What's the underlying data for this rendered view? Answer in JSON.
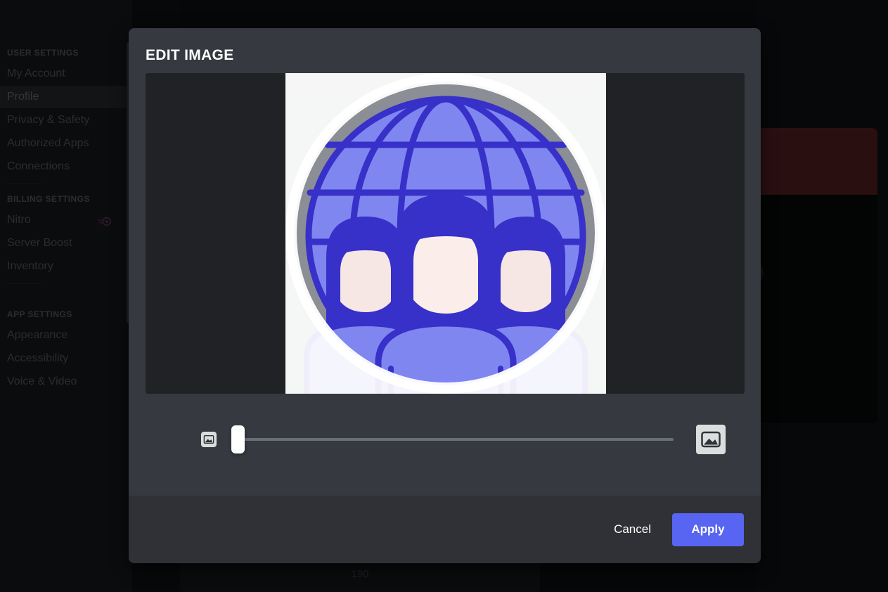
{
  "modal": {
    "title": "EDIT IMAGE",
    "preview": {
      "image_alt": "globe-with-people-avatar",
      "backdrop_color": "#8b8e94",
      "frame_color": "#202225"
    },
    "zoom_slider": {
      "name": "image-zoom-slider",
      "value": 0,
      "min": 0,
      "max": 100,
      "small_icon": "image-icon",
      "large_icon": "image-icon"
    },
    "footer": {
      "cancel_label": "Cancel",
      "apply_label": "Apply",
      "apply_color": "#5865f2"
    },
    "background_color": "#36393f",
    "footer_color": "#2f3136"
  },
  "background": {
    "sidebar": {
      "groups": [
        {
          "header": "USER SETTINGS",
          "items": [
            {
              "label": "My Account",
              "selected": false,
              "badge": null
            },
            {
              "label": "Profile",
              "selected": true,
              "badge": null
            },
            {
              "label": "Privacy & Safety",
              "selected": false,
              "badge": null
            },
            {
              "label": "Authorized Apps",
              "selected": false,
              "badge": null
            },
            {
              "label": "Connections",
              "selected": false,
              "badge": null
            }
          ]
        },
        {
          "header": "BILLING SETTINGS",
          "items": [
            {
              "label": "Nitro",
              "selected": false,
              "badge": "nitro-icon"
            },
            {
              "label": "Server Boost",
              "selected": false,
              "badge": null
            },
            {
              "label": "Inventory",
              "selected": false,
              "badge": null
            }
          ]
        },
        {
          "header": "APP SETTINGS",
          "items": [
            {
              "label": "Appearance",
              "selected": false,
              "badge": null
            },
            {
              "label": "Accessibility",
              "selected": false,
              "badge": null
            },
            {
              "label": "Voice & Video",
              "selected": false,
              "badge": null
            }
          ]
        }
      ]
    },
    "bottom_text": "190",
    "banner_color": "#2a0f11"
  }
}
